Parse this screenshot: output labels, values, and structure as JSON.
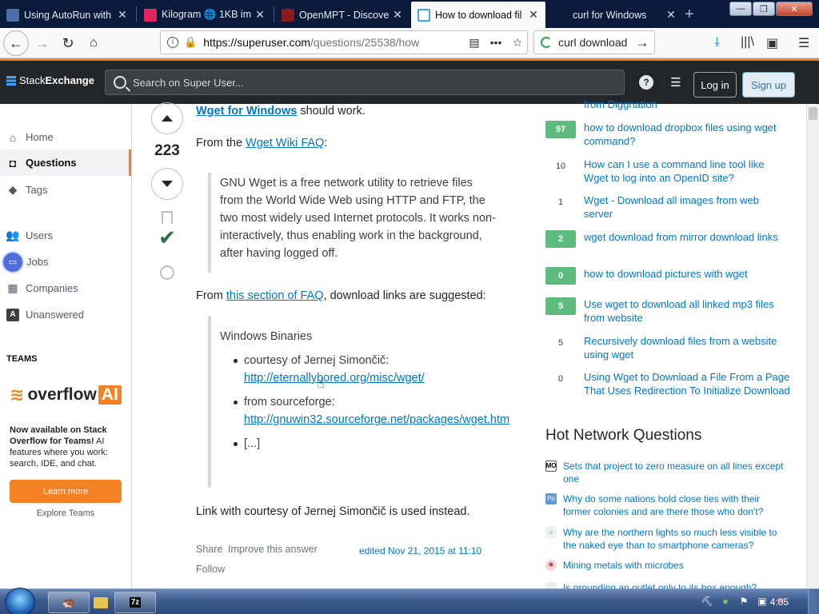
{
  "browser": {
    "tabs": [
      {
        "title": "Using AutoRun with a U",
        "favicon_color": "#4a6fa5"
      },
      {
        "title": "Kilogram 🌐 1KB ima",
        "favicon_color": "#e0245e"
      },
      {
        "title": "OpenMPT - Discover",
        "favicon_color": "#8b1a1a"
      },
      {
        "title": "How to download fil",
        "favicon_color": "#3ca4ff",
        "active": true
      },
      {
        "title": "curl for Windows",
        "favicon_color": "#0a1a3a"
      }
    ],
    "new_tab_label": "+",
    "url_host": "https://superuser.com",
    "url_path": "/questions/25538/how",
    "search_text": "curl download",
    "window_buttons": {
      "minimize": "—",
      "maximize": "❐",
      "close": "✕"
    }
  },
  "header": {
    "logo_stack": "Stack",
    "logo_exchange": "Exchange",
    "search_placeholder": "Search on Super User...",
    "login_label": "Log in",
    "signup_label": "Sign up"
  },
  "leftnav": {
    "items": [
      {
        "label": "Home",
        "icon": "home-icon"
      },
      {
        "label": "Questions",
        "icon": "questions-icon",
        "active": true
      },
      {
        "label": "Tags",
        "icon": "tag-icon"
      },
      {
        "label": "Users",
        "icon": "users-icon"
      },
      {
        "label": "Jobs",
        "icon": "jobs-icon"
      },
      {
        "label": "Companies",
        "icon": "companies-icon"
      },
      {
        "label": "Unanswered",
        "icon": "unanswered-icon"
      }
    ],
    "teams_label": "TEAMS",
    "overflow_brand": "overflow",
    "overflow_ai": "AI",
    "teams_bold": "Now available on Stack Overflow for Teams!",
    "teams_text": " AI features where you work: search, IDE, and chat.",
    "learn_more": "Learn more",
    "explore_teams": "Explore Teams"
  },
  "answer": {
    "score": "223",
    "line1_link": "Wget for Windows",
    "line1_rest": " should work.",
    "from_prefix": "From the ",
    "from_link": "Wget Wiki FAQ",
    "from_suffix": ":",
    "quote1": "GNU Wget is a free network utility to retrieve files from the World Wide Web using HTTP and FTP, the two most widely used Internet protocols. It works non-interactively, thus enabling work in the background, after having logged off.",
    "from2_prefix": "From ",
    "from2_link": "this section of FAQ",
    "from2_suffix": ", download links are suggested:",
    "quote2_title": "Windows Binaries",
    "bullet1_text": "courtesy of Jernej Simončič:",
    "bullet1_link": "http://eternallybored.org/misc/wget/",
    "bullet2_text": "from sourceforge:",
    "bullet2_link": "http://gnuwin32.sourceforge.net/packages/wget.htm",
    "bullet3_text": "[...]",
    "closing": "Link with courtesy of Jernej Simončič is used instead.",
    "share": "Share",
    "improve": "Improve this answer",
    "follow": "Follow",
    "edited": "edited Nov 21, 2015 at 11:10"
  },
  "sidebar": {
    "partial_top": "from Diggnation",
    "related": [
      {
        "count": "97",
        "style": "green",
        "title": "how to download dropbox files using wget command?"
      },
      {
        "count": "10",
        "style": "plain",
        "title": "How can I use a command line tool like Wget to log into an OpenID site?"
      },
      {
        "count": "1",
        "style": "plain",
        "title": "Wget - Download all images from web server"
      },
      {
        "count": "2",
        "style": "green",
        "title": "wget download from mirror download links"
      },
      {
        "count": "0",
        "style": "green",
        "title": "how to download pictures with wget"
      },
      {
        "count": "5",
        "style": "green",
        "title": "Use wget to download all linked mp3 files from website"
      },
      {
        "count": "5",
        "style": "plain",
        "title": "Recursively download files from a website using wget"
      },
      {
        "count": "0",
        "style": "plain",
        "title": "Using Wget to Download a File From a Page That Uses Redirection To Initialize Download"
      }
    ],
    "hnq_title": "Hot Network Questions",
    "hnq": [
      {
        "title": "Sets that project to zero measure on all lines except one",
        "icon_text": "MO",
        "icon_color": "#ffffff"
      },
      {
        "title": "Why do some nations hold close ties with their former colonies and are there those who don't?",
        "icon_text": "Po",
        "icon_color": "#5d9bd6"
      },
      {
        "title": "Why are the northern lights so much less visible to the naked eye than to smartphone cameras?",
        "icon_text": "",
        "icon_color": "#e8f4f0"
      },
      {
        "title": "Mining metals with microbes",
        "icon_text": "",
        "icon_color": "#f5d6d6"
      },
      {
        "title": "Is grounding an outlet only to its box enough?",
        "icon_text": "",
        "icon_color": "#eeeeee"
      }
    ]
  },
  "taskbar": {
    "clock": "4:05",
    "apps": [
      "explorer-icon",
      "folder-icon",
      "7zip-icon"
    ],
    "seven_zip_label": "7z"
  }
}
